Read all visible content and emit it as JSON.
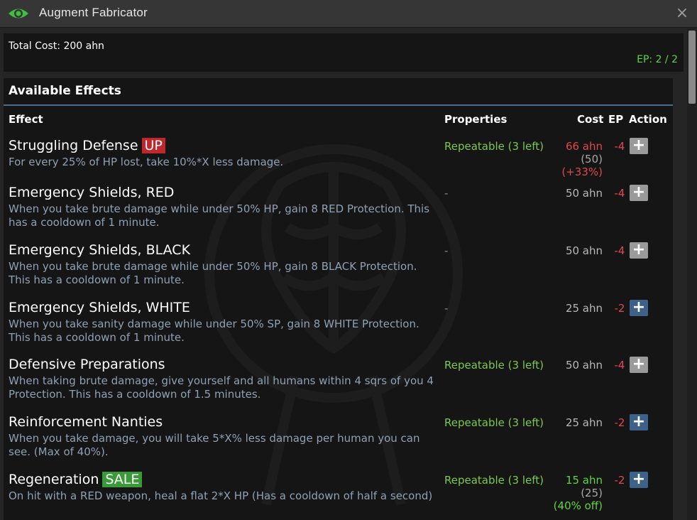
{
  "window": {
    "title": "Augment Fabricator",
    "close_glyph": "×",
    "icon": "eye-icon"
  },
  "summary": {
    "total_cost": "Total Cost: 200 ahn",
    "ep": "EP: 2 / 2"
  },
  "panel": {
    "title": "Available Effects",
    "columns": {
      "effect": "Effect",
      "properties": "Properties",
      "cost": "Cost",
      "ep": "EP",
      "action": "Action"
    }
  },
  "effects": [
    {
      "name": "Struggling Defense",
      "tag": "UP",
      "description": "For every 25% of HP lost, take 10%*X less damage.",
      "properties": "Repeatable (3 left)",
      "cost": "66 ahn",
      "cost_base": "(50)",
      "cost_mod": "(+33%)",
      "ep": "-4",
      "action": "+",
      "action_enabled": false
    },
    {
      "name": "Emergency Shields, RED",
      "tag": "",
      "description": "When you take brute damage while under 50% HP, gain 8 RED Protection. This has a cooldown of 1 minute.",
      "properties": "-",
      "cost": "50 ahn",
      "ep": "-4",
      "action": "+",
      "action_enabled": false
    },
    {
      "name": "Emergency Shields, BLACK",
      "tag": "",
      "description": "When you take brute damage while under 50% HP, gain 8 BLACK Protection. This has a cooldown of 1 minute.",
      "properties": "-",
      "cost": "50 ahn",
      "ep": "-4",
      "action": "+",
      "action_enabled": false
    },
    {
      "name": "Emergency Shields, WHITE",
      "tag": "",
      "description": "When you take sanity damage while under 50% SP, gain 8 WHITE Protection. This has a cooldown of 1 minute.",
      "properties": "-",
      "cost": "25 ahn",
      "ep": "-2",
      "action": "+",
      "action_enabled": true
    },
    {
      "name": "Defensive Preparations",
      "tag": "",
      "description": "When taking brute damage, give yourself and all humans within 4 sqrs of you 4 Protection. This has a cooldown of 1.5 minutes.",
      "properties": "Repeatable (3 left)",
      "cost": "50 ahn",
      "ep": "-4",
      "action": "+",
      "action_enabled": false
    },
    {
      "name": "Reinforcement Nanties",
      "tag": "",
      "description": "When you take damage, you will take 5*X% less damage per human you can see. (Max of 40%).",
      "properties": "Repeatable (3 left)",
      "cost": "25 ahn",
      "ep": "-2",
      "action": "+",
      "action_enabled": true
    },
    {
      "name": "Regeneration",
      "tag": "SALE",
      "description": "On hit with a RED weapon, heal a flat 2*X HP (Has a cooldown of half a second)",
      "properties": "Repeatable (3 left)",
      "cost": "15 ahn",
      "cost_base": "(25)",
      "cost_mod": "(40% off)",
      "ep": "-2",
      "action": "+",
      "action_enabled": true
    }
  ],
  "colors": {
    "accent_green": "#5fd43d",
    "cost_red": "#e0494b",
    "desc_blue_grey": "#8ea1b5",
    "button_disabled": "#9a9a9a",
    "button_enabled": "#3e6189",
    "tag_up": "#c0272d",
    "tag_sale": "#3a9a3a"
  }
}
